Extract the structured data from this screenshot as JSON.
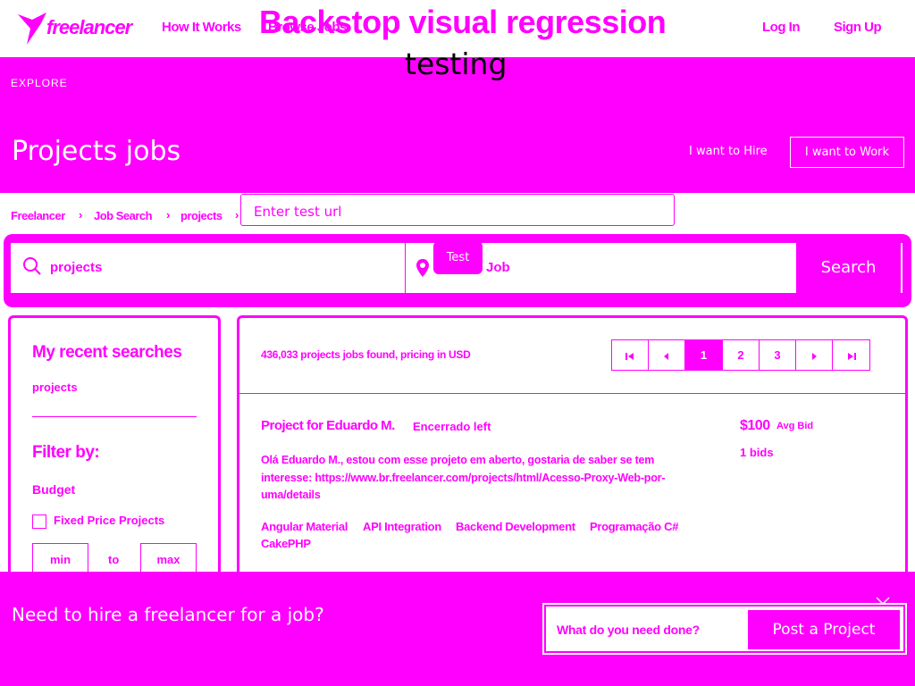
{
  "topnav": {
    "logo_text": "freelancer",
    "how_it_works": "How It Works",
    "browse_jobs": "Browse Jobs",
    "login": "Log In",
    "signup": "Sign Up"
  },
  "overlay": {
    "title": "Backstop visual regression",
    "subtitle": "testing",
    "url_placeholder": "Enter test url",
    "test_button": "Test"
  },
  "band": {
    "explore": "EXPLORE",
    "page_title": "Projects jobs",
    "hire_link": "I want to Hire",
    "work_button": "I want to Work"
  },
  "breadcrumb": [
    "Freelancer",
    "Job Search",
    "projects"
  ],
  "search": {
    "query": "projects",
    "location": "Job",
    "button": "Search"
  },
  "sidebar": {
    "recent_heading": "My recent searches",
    "recent_item": "projects",
    "filter_heading": "Filter by:",
    "budget_heading": "Budget",
    "fixed_price_label": "Fixed Price Projects",
    "min_placeholder": "min",
    "to_label": "to",
    "max_placeholder": "max"
  },
  "results": {
    "count_text": "436,033 projects jobs found, pricing in USD",
    "pages": [
      "1",
      "2",
      "3"
    ],
    "active_page": "1"
  },
  "project": {
    "title": "Project for Eduardo M.",
    "status": "Encerrado left",
    "description": "Olá Eduardo M., estou com esse projeto em aberto, gostaria de saber se tem interesse: https://www.br.freelancer.com/projects/html/Acesso-Proxy-Web-por-uma/details",
    "price": "$100",
    "price_label": "Avg Bid",
    "bids": "1 bids",
    "tags": [
      "Angular Material",
      "API Integration",
      "Backend Development",
      "Programação C#",
      "CakePHP"
    ]
  },
  "banner": {
    "heading": "Need to hire a freelancer for a job?",
    "input_placeholder": "What do you need done?",
    "post_button": "Post a Project"
  },
  "colors": {
    "accent": "#ff00ff",
    "background": "#ffffff",
    "overlay_subtitle": "#000000"
  }
}
